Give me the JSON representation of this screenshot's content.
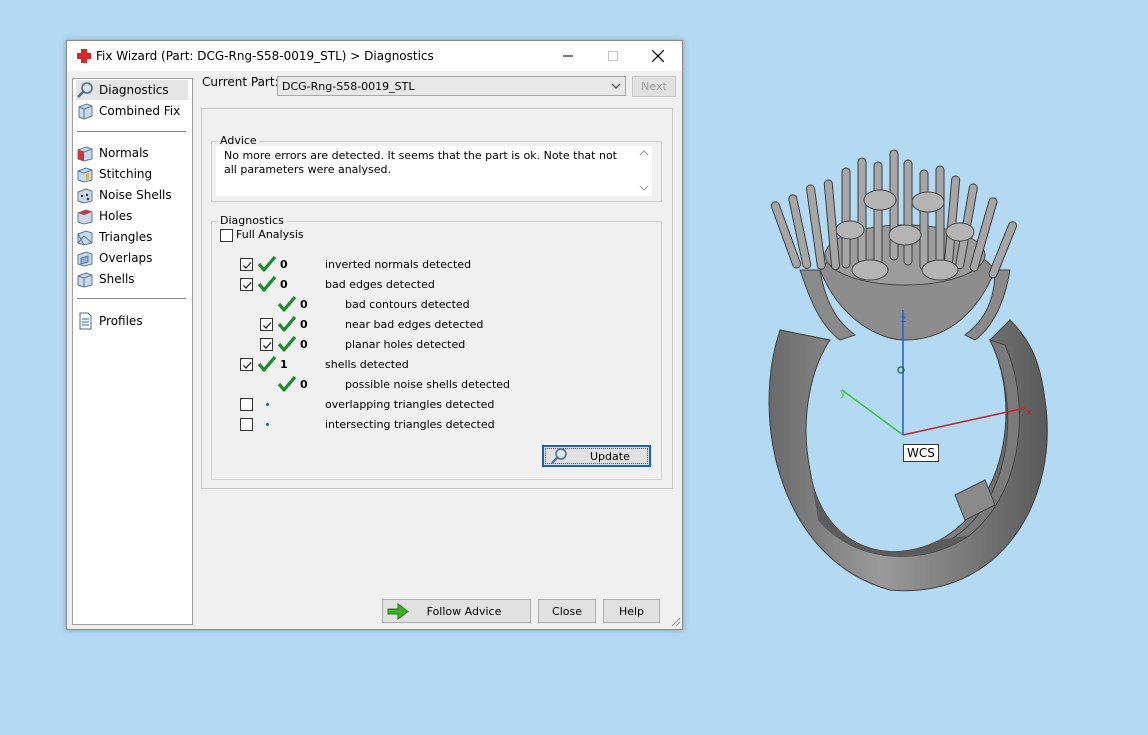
{
  "window": {
    "title": "Fix Wizard (Part: DCG-Rng-S58-0019_STL) > Diagnostics"
  },
  "nav": {
    "items": [
      {
        "label": "Diagnostics",
        "icon": "magnifier-icon"
      },
      {
        "label": "Combined Fix",
        "icon": "combined-fix-icon"
      },
      {
        "label": "Normals",
        "icon": "normals-icon"
      },
      {
        "label": "Stitching",
        "icon": "stitching-icon"
      },
      {
        "label": "Noise Shells",
        "icon": "noise-shells-icon"
      },
      {
        "label": "Holes",
        "icon": "holes-icon"
      },
      {
        "label": "Triangles",
        "icon": "triangles-icon"
      },
      {
        "label": "Overlaps",
        "icon": "overlaps-icon"
      },
      {
        "label": "Shells",
        "icon": "shells-icon"
      },
      {
        "label": "Profiles",
        "icon": "profiles-icon"
      }
    ]
  },
  "header": {
    "current_part_label": "Current Part:",
    "current_part_value": "DCG-Rng-S58-0019_STL",
    "next_label": "Next"
  },
  "advice": {
    "title": "Advice",
    "text": "No more errors are detected. It seems that the part is ok. Note that not all parameters were analysed."
  },
  "diagnostics": {
    "title": "Diagnostics",
    "full_analysis_label": "Full Analysis",
    "full_analysis_checked": false,
    "rows": [
      {
        "checked": true,
        "status": "ok",
        "count": "0",
        "label": "inverted normals detected"
      },
      {
        "checked": true,
        "status": "ok",
        "count": "0",
        "label": "bad edges detected"
      },
      {
        "checked": null,
        "status": "ok",
        "count": "0",
        "label": "bad contours detected"
      },
      {
        "checked": true,
        "status": "ok",
        "count": "0",
        "label": "near bad edges detected"
      },
      {
        "checked": true,
        "status": "ok",
        "count": "0",
        "label": "planar holes detected"
      },
      {
        "checked": true,
        "status": "ok",
        "count": "1",
        "label": "shells detected"
      },
      {
        "checked": null,
        "status": "ok",
        "count": "0",
        "label": "possible noise shells detected"
      },
      {
        "checked": false,
        "status": "pending",
        "count": "",
        "label": "overlapping triangles detected"
      },
      {
        "checked": false,
        "status": "pending",
        "count": "",
        "label": "intersecting triangles detected"
      }
    ],
    "update_label": "Update"
  },
  "footer": {
    "follow_advice_label": "Follow Advice",
    "close_label": "Close",
    "help_label": "Help"
  },
  "viewport": {
    "wcs_label": "WCS",
    "axis_x": "x",
    "axis_y": "y",
    "axis_z": "z"
  },
  "colors": {
    "desktop": "#b4d9f3",
    "check_green": "#1e8a2e",
    "focus_blue": "#1a5eb5",
    "axis_x": "#c0282d",
    "axis_y": "#3cc63c",
    "axis_z": "#2b5fd9"
  }
}
